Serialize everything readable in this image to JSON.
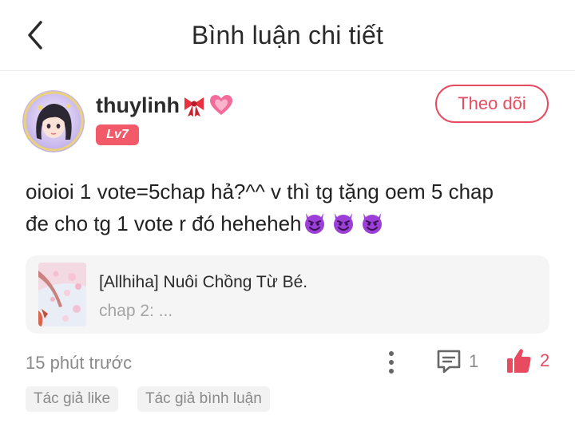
{
  "header": {
    "title": "Bình luận chi tiết",
    "back_icon": "chevron-left-icon"
  },
  "user": {
    "name": "thuylinh",
    "name_emojis": [
      "ribbon-icon",
      "sparkling-heart-icon"
    ],
    "level": "Lv7",
    "follow_label": "Theo dõi"
  },
  "comment": {
    "text_line1": "oioioi 1 vote=5chap hả?^^ v thì tg tặng oem 5 chap",
    "text_line2": "đe cho tg 1 vote r đó heheheh",
    "trailing_emojis": [
      "smiling-devil-icon",
      "smiling-devil-icon",
      "smiling-devil-icon"
    ]
  },
  "story": {
    "title": "[Allhiha] Nuôi Chồng Từ Bé.",
    "subtitle": "chap 2: ..."
  },
  "footer": {
    "time": "15 phút trước",
    "comment_count": "1",
    "like_count": "2"
  },
  "tags": [
    "Tác giả like",
    "Tác giả bình luận"
  ],
  "colors": {
    "accent": "#e64b5f",
    "level_bg": "#f25a6a",
    "devil": "#9b3fd6",
    "muted": "#8a8a8a"
  }
}
